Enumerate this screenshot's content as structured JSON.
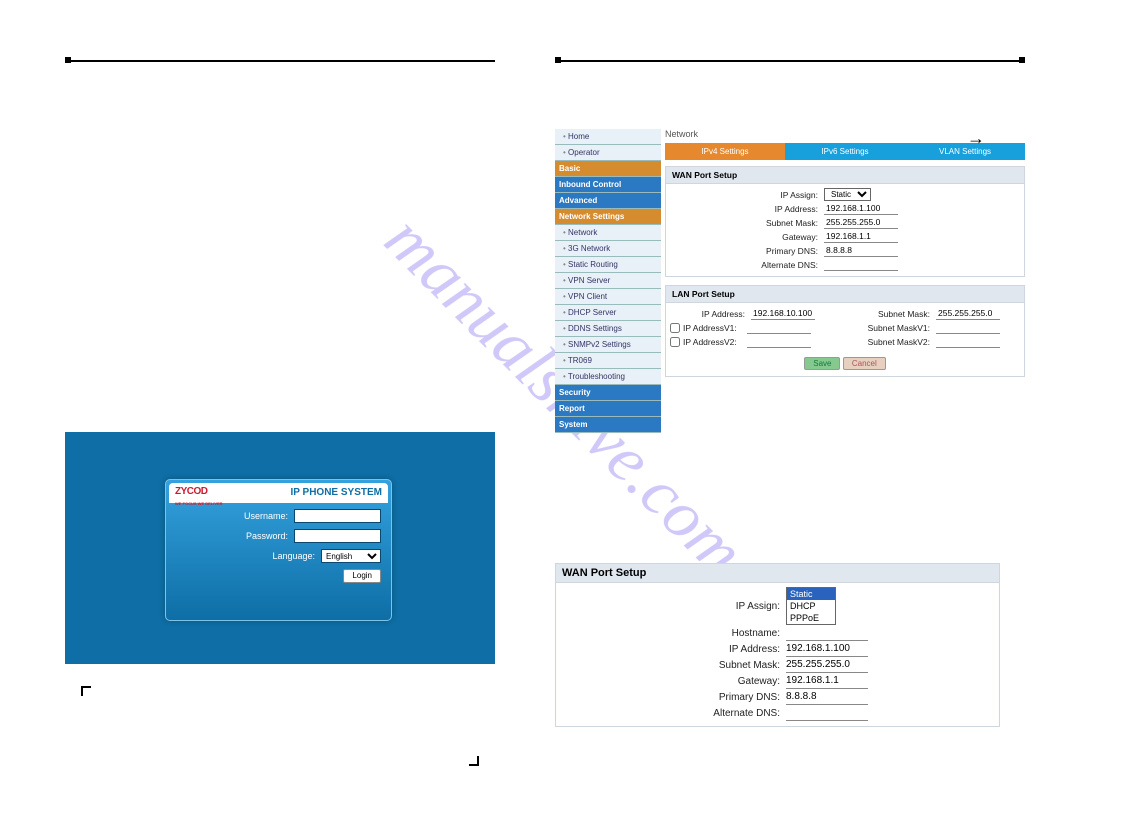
{
  "login": {
    "logo_main": "ZYCOD",
    "logo_sub": "WE FOCUS WE DELIVER",
    "title": "IP PHONE SYSTEM",
    "labels": {
      "username": "Username:",
      "password": "Password:",
      "language": "Language:"
    },
    "language_value": "English",
    "login_btn": "Login"
  },
  "watermark": "manualshive.com",
  "arrow": "→",
  "sidebar": [
    {
      "type": "leaf",
      "label": "Home"
    },
    {
      "type": "leaf",
      "label": "Operator"
    },
    {
      "type": "group",
      "label": "Basic",
      "variant": "orange"
    },
    {
      "type": "group",
      "label": "Inbound Control"
    },
    {
      "type": "group",
      "label": "Advanced"
    },
    {
      "type": "group",
      "label": "Network Settings",
      "variant": "orange"
    },
    {
      "type": "leaf",
      "label": "Network"
    },
    {
      "type": "leaf",
      "label": "3G Network"
    },
    {
      "type": "leaf",
      "label": "Static Routing"
    },
    {
      "type": "leaf",
      "label": "VPN Server"
    },
    {
      "type": "leaf",
      "label": "VPN Client"
    },
    {
      "type": "leaf",
      "label": "DHCP Server"
    },
    {
      "type": "leaf",
      "label": "DDNS Settings"
    },
    {
      "type": "leaf",
      "label": "SNMPv2 Settings"
    },
    {
      "type": "leaf",
      "label": "TR069"
    },
    {
      "type": "leaf",
      "label": "Troubleshooting"
    },
    {
      "type": "group",
      "label": "Security"
    },
    {
      "type": "group",
      "label": "Report"
    },
    {
      "type": "group",
      "label": "System"
    }
  ],
  "breadcrumb": "Network",
  "tabs": {
    "ipv4": "IPv4 Settings",
    "ipv6": "IPv6 Settings",
    "vlan": "VLAN Settings"
  },
  "wan": {
    "title": "WAN Port Setup",
    "ip_assign_label": "IP Assign:",
    "ip_assign_value": "Static",
    "ip_address_label": "IP Address:",
    "ip_address_value": "192.168.1.100",
    "subnet_label": "Subnet Mask:",
    "subnet_value": "255.255.255.0",
    "gateway_label": "Gateway:",
    "gateway_value": "192.168.1.1",
    "pdns_label": "Primary DNS:",
    "pdns_value": "8.8.8.8",
    "adns_label": "Alternate DNS:",
    "adns_value": ""
  },
  "lan": {
    "title": "LAN Port Setup",
    "ip_address_label": "IP Address:",
    "ip_address_value": "192.168.10.100",
    "ipv1_label": "IP AddressV1:",
    "ipv1_value": "",
    "ipv2_label": "IP AddressV2:",
    "ipv2_value": "",
    "subnet_label": "Subnet Mask:",
    "subnet_value": "255.255.255.0",
    "maskv1_label": "Subnet MaskV1:",
    "maskv1_value": "",
    "maskv2_label": "Subnet MaskV2:",
    "maskv2_value": ""
  },
  "buttons": {
    "save": "Save",
    "cancel": "Cancel"
  },
  "wan2": {
    "title": "WAN Port Setup",
    "ip_assign_label": "IP Assign:",
    "options": [
      "Static",
      "DHCP",
      "PPPoE"
    ],
    "hostname_label": "Hostname:",
    "hostname_value": "",
    "ip_address_label": "IP Address:",
    "ip_address_value": "192.168.1.100",
    "subnet_label": "Subnet Mask:",
    "subnet_value": "255.255.255.0",
    "gateway_label": "Gateway:",
    "gateway_value": "192.168.1.1",
    "pdns_label": "Primary DNS:",
    "pdns_value": "8.8.8.8",
    "adns_label": "Alternate DNS:",
    "adns_value": ""
  }
}
